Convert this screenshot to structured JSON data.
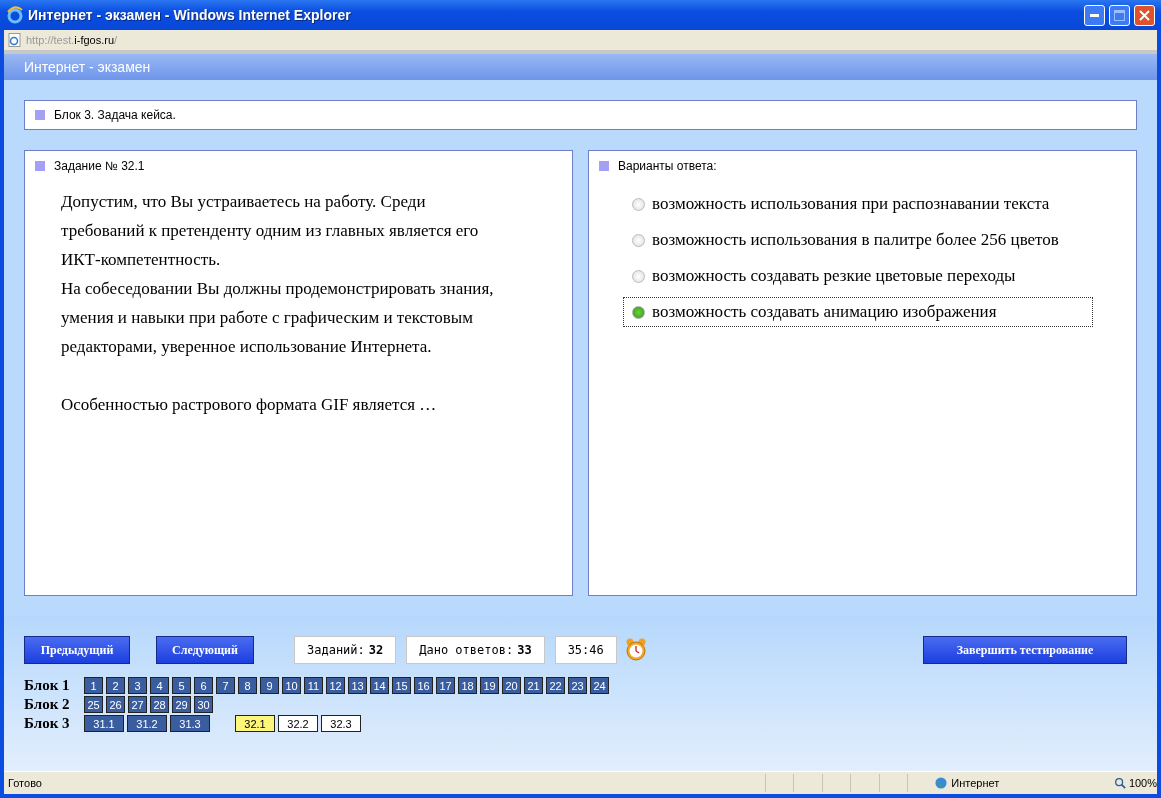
{
  "window": {
    "title": "Интернет - экзамен - Windows Internet Explorer"
  },
  "address": {
    "prefix": "http://test.",
    "domain": "i-fgos.ru",
    "suffix": "/"
  },
  "page_header": "Интернет - экзамен",
  "block_title": "Блок 3. Задача кейса.",
  "task": {
    "title": "Задание № 32.1",
    "paragraphs": [
      "Допустим, что Вы устраиваетесь на работу. Среди требований к претенденту одним из главных является его ИКТ-компетентность.",
      "На собеседовании Вы должны продемонстрировать знания, умения и навыки при работе с графическим и текстовым редакторами, уверенное использование Интернета.",
      "Особенностью растрового формата GIF является …"
    ]
  },
  "answers": {
    "title": "Варианты ответа:",
    "options": [
      {
        "label": "возможность использования при распознавании текста",
        "selected": false
      },
      {
        "label": "возможность использования в палитре более 256 цветов",
        "selected": false
      },
      {
        "label": "возможность создавать резкие цветовые переходы",
        "selected": false
      },
      {
        "label": "возможность создавать анимацию изображения",
        "selected": true
      }
    ]
  },
  "buttons": {
    "prev": "Предыдущий",
    "next": "Следующий",
    "finish": "Завершить тестирование"
  },
  "counters": [
    {
      "label": "Заданий:",
      "value": "32"
    },
    {
      "label": "Дано ответов:",
      "value": "33"
    }
  ],
  "timer": "35:46",
  "blocks": [
    {
      "label": "Блок 1",
      "groups": [
        [
          {
            "label": "1",
            "kind": "answered"
          },
          {
            "label": "2",
            "kind": "answered"
          },
          {
            "label": "3",
            "kind": "answered"
          },
          {
            "label": "4",
            "kind": "answered"
          },
          {
            "label": "5",
            "kind": "answered"
          },
          {
            "label": "6",
            "kind": "answered"
          },
          {
            "label": "7",
            "kind": "answered"
          },
          {
            "label": "8",
            "kind": "answered"
          },
          {
            "label": "9",
            "kind": "answered"
          },
          {
            "label": "10",
            "kind": "answered"
          },
          {
            "label": "11",
            "kind": "answered"
          },
          {
            "label": "12",
            "kind": "answered"
          },
          {
            "label": "13",
            "kind": "answered"
          },
          {
            "label": "14",
            "kind": "answered"
          },
          {
            "label": "15",
            "kind": "answered"
          },
          {
            "label": "16",
            "kind": "answered"
          },
          {
            "label": "17",
            "kind": "answered"
          },
          {
            "label": "18",
            "kind": "answered"
          },
          {
            "label": "19",
            "kind": "answered"
          },
          {
            "label": "20",
            "kind": "answered"
          },
          {
            "label": "21",
            "kind": "answered"
          },
          {
            "label": "22",
            "kind": "answered"
          },
          {
            "label": "23",
            "kind": "answered"
          },
          {
            "label": "24",
            "kind": "answered"
          }
        ]
      ]
    },
    {
      "label": "Блок 2",
      "groups": [
        [
          {
            "label": "25",
            "kind": "answered"
          },
          {
            "label": "26",
            "kind": "answered"
          },
          {
            "label": "27",
            "kind": "answered"
          },
          {
            "label": "28",
            "kind": "answered"
          },
          {
            "label": "29",
            "kind": "answered"
          },
          {
            "label": "30",
            "kind": "answered"
          }
        ]
      ]
    },
    {
      "label": "Блок 3",
      "groups": [
        [
          {
            "label": "31.1",
            "kind": "answered"
          },
          {
            "label": "31.2",
            "kind": "answered"
          },
          {
            "label": "31.3",
            "kind": "answered"
          }
        ],
        [
          {
            "label": "32.1",
            "kind": "current"
          },
          {
            "label": "32.2",
            "kind": "unanswered"
          },
          {
            "label": "32.3",
            "kind": "unanswered"
          }
        ]
      ]
    }
  ],
  "status_bar": {
    "text": "Готово",
    "zone": "Интернет",
    "zoom": "100%"
  }
}
